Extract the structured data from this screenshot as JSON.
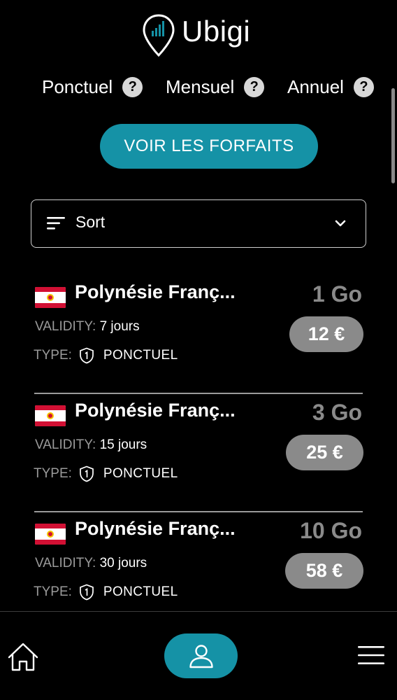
{
  "brand": {
    "name": "Ubigi"
  },
  "plan_types": [
    {
      "label": "Ponctuel",
      "help": "?"
    },
    {
      "label": "Mensuel",
      "help": "?"
    },
    {
      "label": "Annuel",
      "help": "?"
    }
  ],
  "cta": {
    "label": "VOIR LES FORFAITS"
  },
  "sort": {
    "label": "Sort"
  },
  "plans": [
    {
      "country": "Polynésie Françai",
      "data": "1 Go",
      "validity_label": "VALIDITY:",
      "validity": "7 jours",
      "type_label": "TYPE:",
      "type": "PONCTUEL",
      "price": "12 €"
    },
    {
      "country": "Polynésie Françai",
      "data": "3 Go",
      "validity_label": "VALIDITY:",
      "validity": "15 jours",
      "type_label": "TYPE:",
      "type": "PONCTUEL",
      "price": "25 €"
    },
    {
      "country": "Polynésie Françai",
      "data": "10 Go",
      "validity_label": "VALIDITY:",
      "validity": "30 jours",
      "type_label": "TYPE:",
      "type": "PONCTUEL",
      "price": "58 €"
    }
  ],
  "nav": {
    "home": "home-icon",
    "profile": "user-icon",
    "menu": "menu-icon"
  },
  "colors": {
    "accent": "#1592a6",
    "background": "#000000",
    "muted": "#8a8a8a"
  }
}
